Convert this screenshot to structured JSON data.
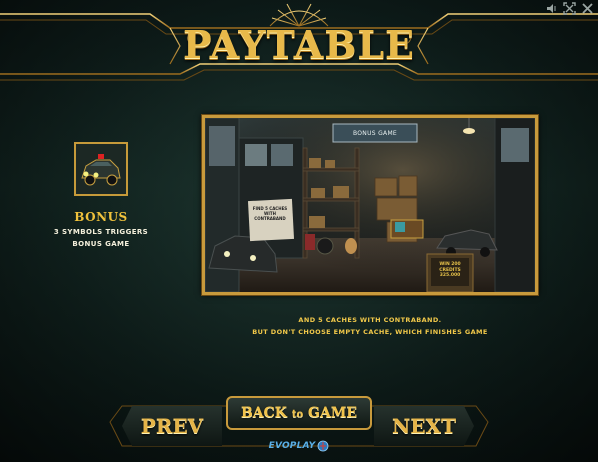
{
  "header": {
    "title": "PAYTABLE"
  },
  "window_controls": [
    {
      "name": "sound-icon"
    },
    {
      "name": "fullscreen-icon"
    },
    {
      "name": "close-icon"
    }
  ],
  "symbol": {
    "icon": "car-symbol",
    "title": "BONUS",
    "line1": "3 SYMBOLS TRIGGERS",
    "line2": "BONUS GAME"
  },
  "scene": {
    "sign": "BONUS GAME",
    "note": "FIND 5 CACHES WITH CONTRABAND",
    "crate": "WIN 200 CREDITS 325.000"
  },
  "description": {
    "line1": "AND 5 CACHES WITH CONTRABAND.",
    "line2": "BUT DON'T CHOOSE EMPTY CACHE, WHICH FINISHES GAME"
  },
  "nav": {
    "prev": "PREV",
    "next": "NEXT",
    "back_main": "BACK",
    "back_small": "to",
    "back_end": "GAME",
    "logo": "EVOPLAY"
  },
  "colors": {
    "gold": "#e8b94a",
    "frame": "#c89a3c",
    "bg": "#0a1412"
  }
}
